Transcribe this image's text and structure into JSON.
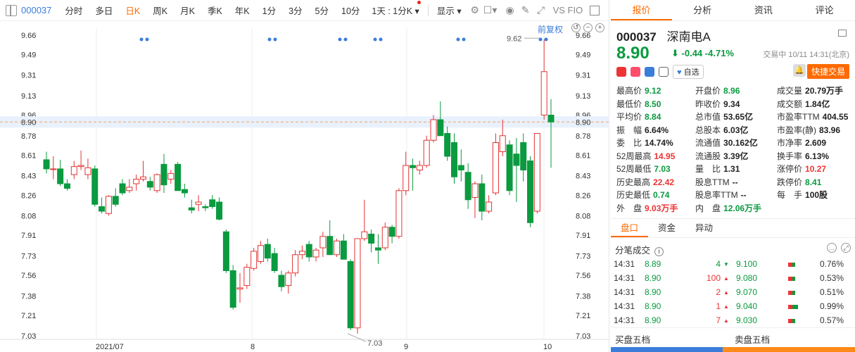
{
  "toolbar": {
    "code": "000037",
    "tabs": [
      "分时",
      "多日",
      "日K",
      "周K",
      "月K",
      "季K",
      "年K",
      "1分",
      "3分",
      "5分",
      "10分"
    ],
    "active_tab": "日K",
    "period_select": "1天 : 1分K",
    "display_menu": "显示",
    "vs_label": "VS FIO",
    "icons": [
      "grid-icon",
      "settings-icon",
      "checkbox-icon",
      "camera-icon",
      "pencil-icon",
      "resize-icon",
      "window-icon"
    ]
  },
  "chart": {
    "restore_label": "前复权",
    "current_price_label": "8.90",
    "y_ticks": [
      "9.66",
      "9.49",
      "9.31",
      "9.13",
      "8.96",
      "8.78",
      "8.61",
      "8.43",
      "8.26",
      "8.08",
      "7.91",
      "7.73",
      "7.56",
      "7.38",
      "7.21",
      "7.03"
    ],
    "x_labels": [
      "2021/07",
      "8",
      "9",
      "10"
    ],
    "high_label": "9.62",
    "low_label": "7.03"
  },
  "chart_data": {
    "type": "candlestick",
    "y_range": [
      7.0,
      9.72
    ],
    "last_price": 8.9,
    "candles": [
      {
        "o": 8.57,
        "h": 8.64,
        "l": 8.45,
        "c": 8.49
      },
      {
        "o": 8.49,
        "h": 8.6,
        "l": 8.4,
        "c": 8.49
      },
      {
        "o": 8.49,
        "h": 8.57,
        "l": 8.34,
        "c": 8.36
      },
      {
        "o": 8.36,
        "h": 8.4,
        "l": 8.3,
        "c": 8.32
      },
      {
        "o": 8.44,
        "h": 8.56,
        "l": 8.4,
        "c": 8.51
      },
      {
        "o": 8.51,
        "h": 8.65,
        "l": 8.48,
        "c": 8.52
      },
      {
        "o": 8.44,
        "h": 8.58,
        "l": 8.4,
        "c": 8.5
      },
      {
        "o": 8.49,
        "h": 8.52,
        "l": 8.16,
        "c": 8.18
      },
      {
        "o": 8.16,
        "h": 8.24,
        "l": 8.1,
        "c": 8.12
      },
      {
        "o": 8.1,
        "h": 8.26,
        "l": 8.08,
        "c": 8.25
      },
      {
        "o": 8.25,
        "h": 8.32,
        "l": 8.16,
        "c": 8.18
      },
      {
        "o": 8.36,
        "h": 8.4,
        "l": 8.26,
        "c": 8.28
      },
      {
        "o": 8.3,
        "h": 8.4,
        "l": 8.28,
        "c": 8.33
      },
      {
        "o": 8.36,
        "h": 8.44,
        "l": 8.3,
        "c": 8.4
      },
      {
        "o": 8.4,
        "h": 8.56,
        "l": 8.38,
        "c": 8.42
      },
      {
        "o": 8.38,
        "h": 8.42,
        "l": 8.3,
        "c": 8.33
      },
      {
        "o": 8.3,
        "h": 8.45,
        "l": 8.28,
        "c": 8.44
      },
      {
        "o": 8.53,
        "h": 8.62,
        "l": 8.28,
        "c": 8.35
      },
      {
        "o": 8.4,
        "h": 8.48,
        "l": 8.36,
        "c": 8.45
      },
      {
        "o": 8.53,
        "h": 8.55,
        "l": 8.3,
        "c": 8.3
      },
      {
        "o": 8.31,
        "h": 8.36,
        "l": 8.24,
        "c": 8.28
      },
      {
        "o": 8.15,
        "h": 8.22,
        "l": 8.1,
        "c": 8.13
      },
      {
        "o": 8.18,
        "h": 8.26,
        "l": 8.12,
        "c": 8.2
      },
      {
        "o": 8.16,
        "h": 8.18,
        "l": 8.12,
        "c": 8.15
      },
      {
        "o": 8.22,
        "h": 8.26,
        "l": 8.14,
        "c": 8.16
      },
      {
        "o": 8.2,
        "h": 8.24,
        "l": 8.04,
        "c": 8.05
      },
      {
        "o": 7.94,
        "h": 7.96,
        "l": 7.58,
        "c": 7.6
      },
      {
        "o": 7.6,
        "h": 7.65,
        "l": 7.26,
        "c": 7.28
      },
      {
        "o": 7.44,
        "h": 7.58,
        "l": 7.32,
        "c": 7.45
      },
      {
        "o": 7.47,
        "h": 7.66,
        "l": 7.44,
        "c": 7.63
      },
      {
        "o": 7.62,
        "h": 7.8,
        "l": 7.6,
        "c": 7.77
      },
      {
        "o": 7.68,
        "h": 7.86,
        "l": 7.66,
        "c": 7.82
      },
      {
        "o": 7.83,
        "h": 7.88,
        "l": 7.68,
        "c": 7.71
      },
      {
        "o": 7.75,
        "h": 7.8,
        "l": 7.58,
        "c": 7.6
      },
      {
        "o": 7.56,
        "h": 7.6,
        "l": 7.42,
        "c": 7.46
      },
      {
        "o": 7.47,
        "h": 7.6,
        "l": 7.4,
        "c": 7.58
      },
      {
        "o": 7.58,
        "h": 7.78,
        "l": 7.55,
        "c": 7.74
      },
      {
        "o": 7.74,
        "h": 7.82,
        "l": 7.7,
        "c": 7.77
      },
      {
        "o": 7.83,
        "h": 7.86,
        "l": 7.68,
        "c": 7.72
      },
      {
        "o": 7.72,
        "h": 7.8,
        "l": 7.68,
        "c": 7.78
      },
      {
        "o": 7.8,
        "h": 7.94,
        "l": 7.72,
        "c": 7.9
      },
      {
        "o": 7.9,
        "h": 8.04,
        "l": 7.86,
        "c": 7.74
      },
      {
        "o": 7.74,
        "h": 7.88,
        "l": 7.72,
        "c": 7.86
      },
      {
        "o": 7.86,
        "h": 7.92,
        "l": 7.78,
        "c": 7.7
      },
      {
        "o": 7.68,
        "h": 7.7,
        "l": 7.08,
        "c": 7.1
      },
      {
        "o": 7.1,
        "h": 7.76,
        "l": 7.05,
        "c": 7.88
      },
      {
        "o": 7.88,
        "h": 8.22,
        "l": 7.86,
        "c": 7.94
      },
      {
        "o": 7.92,
        "h": 7.96,
        "l": 7.76,
        "c": 7.84
      },
      {
        "o": 7.8,
        "h": 7.92,
        "l": 7.66,
        "c": 7.78
      },
      {
        "o": 7.8,
        "h": 8.02,
        "l": 7.78,
        "c": 7.98
      },
      {
        "o": 7.98,
        "h": 8.0,
        "l": 7.84,
        "c": 7.9
      },
      {
        "o": 7.9,
        "h": 8.32,
        "l": 7.88,
        "c": 8.3
      },
      {
        "o": 8.3,
        "h": 8.64,
        "l": 8.26,
        "c": 8.52
      },
      {
        "o": 8.52,
        "h": 8.58,
        "l": 8.3,
        "c": 8.5
      },
      {
        "o": 8.48,
        "h": 8.56,
        "l": 8.44,
        "c": 8.52
      },
      {
        "o": 8.52,
        "h": 8.78,
        "l": 8.5,
        "c": 8.74
      },
      {
        "o": 8.74,
        "h": 8.96,
        "l": 8.72,
        "c": 8.92
      },
      {
        "o": 8.92,
        "h": 9.08,
        "l": 8.8,
        "c": 8.78
      },
      {
        "o": 8.8,
        "h": 8.86,
        "l": 8.56,
        "c": 8.6
      },
      {
        "o": 8.72,
        "h": 8.8,
        "l": 8.36,
        "c": 8.42
      },
      {
        "o": 8.52,
        "h": 8.66,
        "l": 8.38,
        "c": 8.48
      },
      {
        "o": 8.46,
        "h": 8.54,
        "l": 8.14,
        "c": 8.22
      },
      {
        "o": 8.24,
        "h": 8.38,
        "l": 8.06,
        "c": 8.36
      },
      {
        "o": 8.36,
        "h": 8.44,
        "l": 8.04,
        "c": 8.12
      },
      {
        "o": 8.12,
        "h": 8.26,
        "l": 8.1,
        "c": 8.2
      },
      {
        "o": 8.28,
        "h": 8.8,
        "l": 8.26,
        "c": 8.72
      },
      {
        "o": 8.64,
        "h": 8.92,
        "l": 8.6,
        "c": 8.78
      },
      {
        "o": 8.7,
        "h": 8.74,
        "l": 8.26,
        "c": 8.3
      },
      {
        "o": 8.62,
        "h": 8.76,
        "l": 8.2,
        "c": 8.52
      },
      {
        "o": 8.72,
        "h": 8.8,
        "l": 8.38,
        "c": 8.48
      },
      {
        "o": 8.56,
        "h": 8.6,
        "l": 7.98,
        "c": 8.02
      },
      {
        "o": 8.12,
        "h": 8.8,
        "l": 8.1,
        "c": 8.8
      },
      {
        "o": 8.96,
        "h": 9.62,
        "l": 8.92,
        "c": 9.34
      },
      {
        "o": 8.96,
        "h": 9.1,
        "l": 8.5,
        "c": 8.9
      }
    ]
  },
  "quote": {
    "code": "000037",
    "name": "深南电A",
    "price": "8.90",
    "price_arrow": "⬇",
    "change": "-0.44",
    "change_pct": "-4.71%",
    "status": "交易中 10/11 14:31(北京)",
    "watch_label": "自选",
    "quick_trade": "快捷交易",
    "fields": [
      {
        "k": "最高价",
        "v": "9.12",
        "c": "dn"
      },
      {
        "k": "开盘价",
        "v": "8.96",
        "c": "dn"
      },
      {
        "k": "成交量",
        "v": "20.79万手",
        "c": "nt"
      },
      {
        "k": "最低价",
        "v": "8.50",
        "c": "dn"
      },
      {
        "k": "昨收价",
        "v": "9.34",
        "c": "nt"
      },
      {
        "k": "成交额",
        "v": "1.84亿",
        "c": "nt"
      },
      {
        "k": "平均价",
        "v": "8.84",
        "c": "dn"
      },
      {
        "k": "总市值",
        "v": "53.65亿",
        "c": "nt"
      },
      {
        "k": "市盈率TTM",
        "v": "404.55",
        "c": "nt"
      },
      {
        "k": "振　幅",
        "v": "6.64%",
        "c": "nt"
      },
      {
        "k": "总股本",
        "v": "6.03亿",
        "c": "nt"
      },
      {
        "k": "市盈率(静)",
        "v": "83.96",
        "c": "nt"
      },
      {
        "k": "委　比",
        "v": "14.74%",
        "c": "nt"
      },
      {
        "k": "流通值",
        "v": "30.162亿",
        "c": "nt"
      },
      {
        "k": "市净率",
        "v": "2.609",
        "c": "nt"
      },
      {
        "k": "52周最高",
        "v": "14.95",
        "c": "up"
      },
      {
        "k": "流通股",
        "v": "3.39亿",
        "c": "nt"
      },
      {
        "k": "换手率",
        "v": "6.13%",
        "c": "nt"
      },
      {
        "k": "52周最低",
        "v": "7.03",
        "c": "dn"
      },
      {
        "k": "量　比",
        "v": "1.31",
        "c": "nt"
      },
      {
        "k": "涨停价",
        "v": "10.27",
        "c": "up"
      },
      {
        "k": "历史最高",
        "v": "22.42",
        "c": "up"
      },
      {
        "k": "股息TTM",
        "v": "--",
        "c": "nt"
      },
      {
        "k": "跌停价",
        "v": "8.41",
        "c": "dn"
      },
      {
        "k": "历史最低",
        "v": "0.74",
        "c": "dn"
      },
      {
        "k": "股息率TTM",
        "v": "--",
        "c": "nt"
      },
      {
        "k": "每　手",
        "v": "100股",
        "c": "nt"
      },
      {
        "k": "外　盘",
        "v": "9.03万手",
        "c": "up"
      },
      {
        "k": "内　盘",
        "v": "12.06万手",
        "c": "dn"
      },
      {
        "k": "",
        "v": "",
        "c": "nt"
      }
    ]
  },
  "sub_tabs": [
    "盘口",
    "资金",
    "异动"
  ],
  "ticks": {
    "title": "分笔成交",
    "rows": [
      {
        "time": "14:31",
        "price": "8.89",
        "vol": "4",
        "dir": "down",
        "sprice": "9.100",
        "pct": "0.76%"
      },
      {
        "time": "14:31",
        "price": "8.90",
        "vol": "100",
        "dir": "up",
        "sprice": "9.080",
        "pct": "0.53%"
      },
      {
        "time": "14:31",
        "price": "8.90",
        "vol": "2",
        "dir": "up",
        "sprice": "9.070",
        "pct": "0.51%"
      },
      {
        "time": "14:31",
        "price": "8.90",
        "vol": "1",
        "dir": "up",
        "sprice": "9.040",
        "pct": "0.99%"
      },
      {
        "time": "14:31",
        "price": "8.90",
        "vol": "7",
        "dir": "up",
        "sprice": "9.030",
        "pct": "0.57%"
      }
    ]
  },
  "fifth": {
    "buy": "买盘五档",
    "sell": "卖盘五档",
    "buy_pct": "45.78%",
    "sell_pct": "54.27%"
  },
  "colors": {
    "up": "#e33333",
    "down": "#0a9a3f",
    "accent": "#ff6a00",
    "link": "#3a7ddb"
  }
}
